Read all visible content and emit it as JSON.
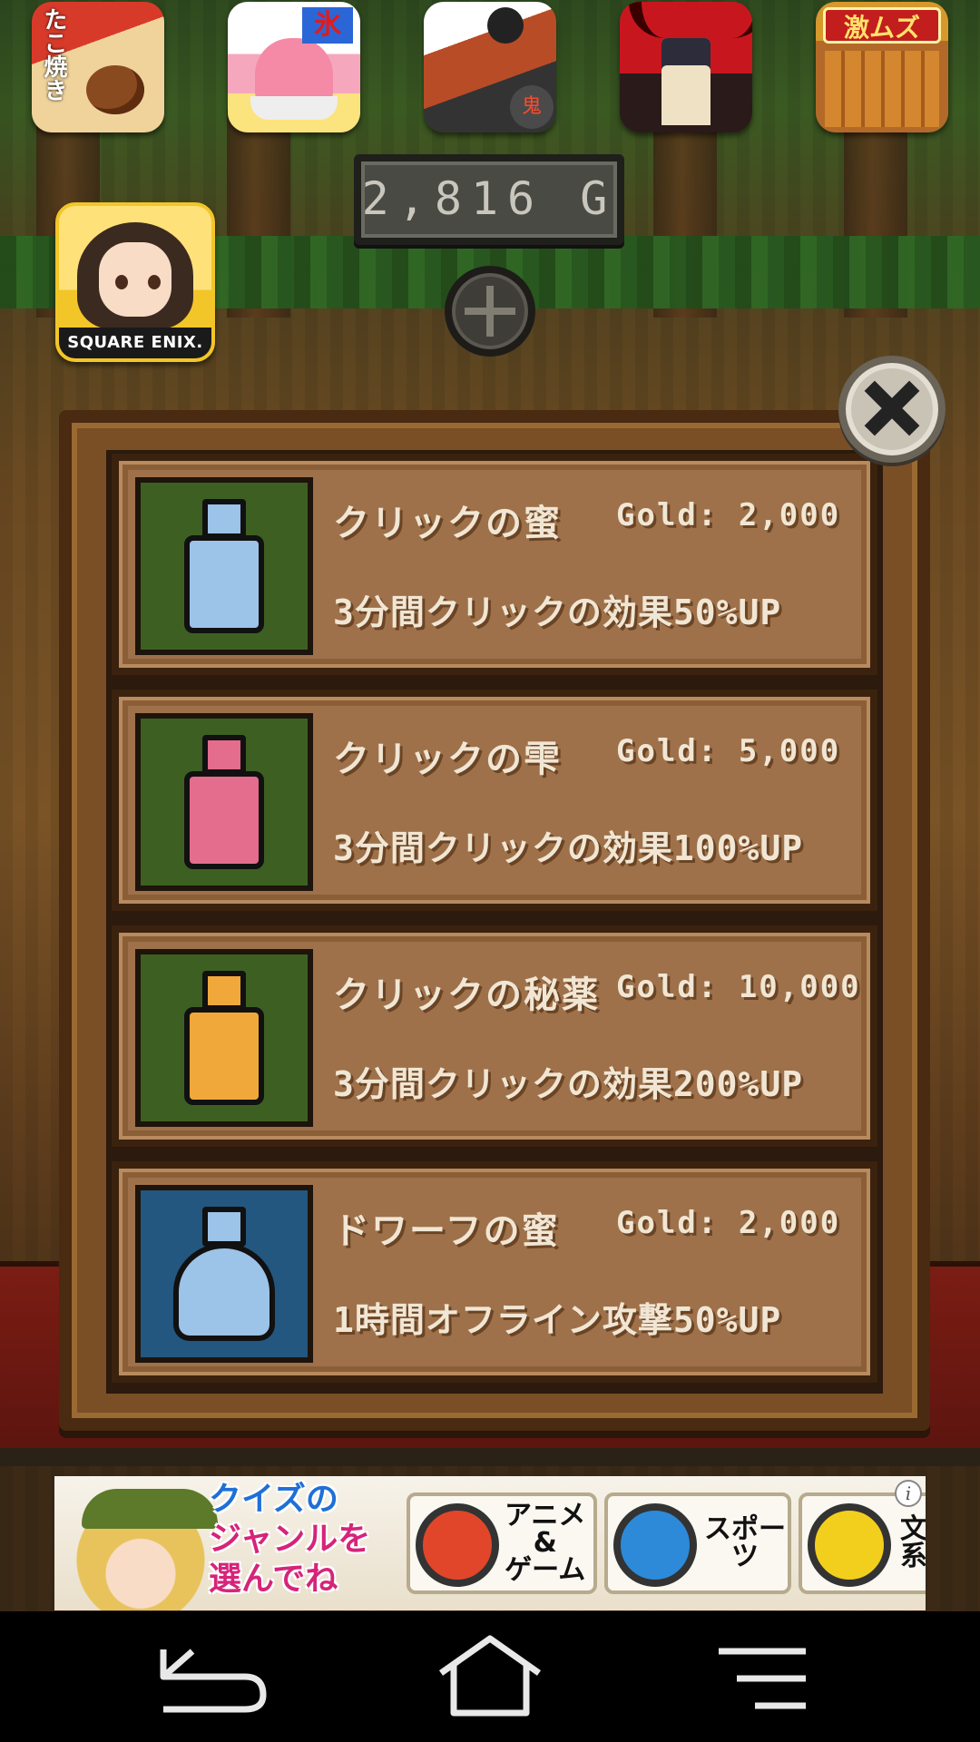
{
  "top_apps": [
    {
      "name": "takoyaki-app-icon",
      "label": "たこ焼き"
    },
    {
      "name": "kakigori-app-icon",
      "label": "氷"
    },
    {
      "name": "oni-app-icon",
      "label": "鬼"
    },
    {
      "name": "hero-app-icon",
      "label": ""
    },
    {
      "name": "maze-app-icon",
      "label": "激ムズ"
    }
  ],
  "square_enix_app": {
    "brand": "SQUARE ENIX."
  },
  "gold": {
    "amount": "2,816 G"
  },
  "shop": {
    "items": [
      {
        "name": "クリックの蜜",
        "price": "Gold: 2,000",
        "description": "3分間クリックの効果50%UP",
        "potion_color": "#9cc3e8",
        "thumb_bg": "green",
        "shape": "square"
      },
      {
        "name": "クリックの雫",
        "price": "Gold: 5,000",
        "description": "3分間クリックの効果100%UP",
        "potion_color": "#e46c8c",
        "thumb_bg": "green",
        "shape": "square"
      },
      {
        "name": "クリックの秘薬",
        "price": "Gold: 10,000",
        "description": "3分間クリックの効果200%UP",
        "potion_color": "#f1a83a",
        "thumb_bg": "green",
        "shape": "square"
      },
      {
        "name": "ドワーフの蜜",
        "price": "Gold: 2,000",
        "description": "1時間オフライン攻撃50%UP",
        "potion_color": "#9cc3e8",
        "thumb_bg": "blue",
        "shape": "round"
      }
    ]
  },
  "ad": {
    "headline_1": "クイズの",
    "headline_2": "ジャンルを",
    "headline_3": "選んでね",
    "choices": [
      {
        "label": "アニメ\n&\nゲーム",
        "color": "#e2462a"
      },
      {
        "label": "スポーツ",
        "color": "#2d8ad8"
      },
      {
        "label": "文系",
        "color": "#f2cf1c"
      }
    ],
    "info_label": "i"
  },
  "colors": {
    "panel_wood": "#7a4f26",
    "item_wood": "#9e714a",
    "text_cream": "#f1e6d4"
  }
}
